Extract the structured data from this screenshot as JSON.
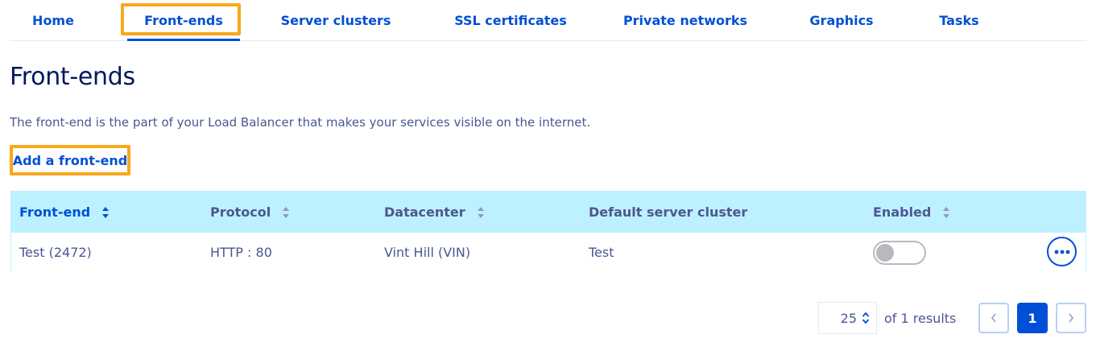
{
  "tabs": [
    {
      "label": "Home",
      "active": false
    },
    {
      "label": "Front-ends",
      "active": true
    },
    {
      "label": "Server clusters",
      "active": false
    },
    {
      "label": "SSL certificates",
      "active": false
    },
    {
      "label": "Private networks",
      "active": false
    },
    {
      "label": "Graphics",
      "active": false
    },
    {
      "label": "Tasks",
      "active": false
    }
  ],
  "page": {
    "title": "Front-ends",
    "description": "The front-end is the part of your Load Balancer that makes your services visible on the internet.",
    "add_label": "Add a front-end"
  },
  "table": {
    "headers": [
      "Front-end",
      "Protocol",
      "Datacenter",
      "Default server cluster",
      "Enabled"
    ],
    "rows": [
      {
        "frontend": "Test (2472)",
        "protocol": "HTTP : 80",
        "datacenter": "Vint Hill (VIN)",
        "cluster": "Test",
        "enabled": false
      }
    ]
  },
  "pagination": {
    "page_size": "25",
    "results_label": "of 1 results",
    "current_page": "1"
  },
  "icons": {
    "sort": "sort-icon",
    "more": "more-options-icon",
    "chevron_left": "chevron-left-icon",
    "chevron_right": "chevron-right-icon",
    "updown": "chevron-updown-icon"
  },
  "colors": {
    "primary": "#0050d7",
    "title": "#00185e",
    "text": "#4d5693",
    "header_bg": "#bef1ff",
    "highlight": "#f8a81b"
  }
}
